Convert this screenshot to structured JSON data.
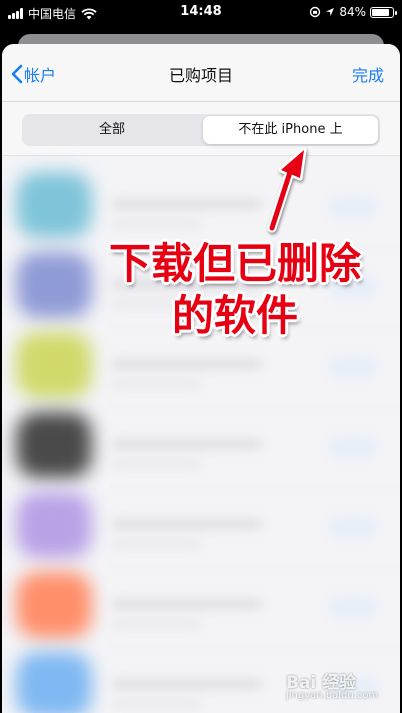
{
  "status_bar": {
    "carrier": "中国电信",
    "time": "14:48",
    "battery_text": "84%",
    "battery_level": 0.84
  },
  "nav": {
    "back_label": "帐户",
    "title": "已购项目",
    "done_label": "完成"
  },
  "segmented": {
    "all_label": "全部",
    "not_on_device_label": "不在此 iPhone 上",
    "selected": "not_on_device"
  },
  "annotation": {
    "line1": "下载但已删除",
    "line2": "的软件",
    "color": "#e60012"
  },
  "apps": [
    {
      "icon_color": "#7fc4d9"
    },
    {
      "icon_color": "#8f9bd6"
    },
    {
      "icon_color": "#d0d96a"
    },
    {
      "icon_color": "#4a4a4a"
    },
    {
      "icon_color": "#b9a2e6"
    },
    {
      "icon_color": "#ff8f6b"
    },
    {
      "icon_color": "#7fb8f2"
    }
  ],
  "watermark": {
    "logo": "Bai 经验",
    "url": "jingyan.baidu.com"
  }
}
